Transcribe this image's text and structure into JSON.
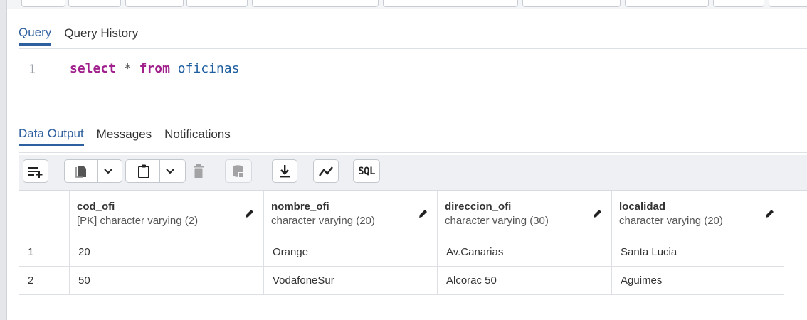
{
  "query_tabs": [
    "Query",
    "Query History"
  ],
  "editor": {
    "line_number": "1",
    "keyword_select": "select",
    "operator": "*",
    "keyword_from": "from",
    "table_name": "oficinas"
  },
  "output_tabs": [
    "Data Output",
    "Messages",
    "Notifications"
  ],
  "toolbar": {
    "sql_label": "SQL",
    "icons": [
      "add-row-icon",
      "copy-icon",
      "dropdown-chevron-icon",
      "paste-icon",
      "dropdown-chevron-icon",
      "delete-icon",
      "save-data-icon",
      "download-icon",
      "graph-icon",
      "sql-icon"
    ]
  },
  "columns": [
    {
      "name": "cod_ofi",
      "type": "[PK] character varying (2)"
    },
    {
      "name": "nombre_ofi",
      "type": "character varying (20)"
    },
    {
      "name": "direccion_ofi",
      "type": "character varying (30)"
    },
    {
      "name": "localidad",
      "type": "character varying (20)"
    }
  ],
  "rows": [
    {
      "num": "1",
      "cells": [
        "20",
        "Orange",
        "Av.Canarias",
        "Santa Lucia"
      ]
    },
    {
      "num": "2",
      "cells": [
        "50",
        "VodafoneSur",
        "Alcorac 50",
        "Aguimes"
      ]
    }
  ],
  "colors": {
    "accent": "#2e5f9e",
    "keyword": "#a0218c",
    "identifier": "#1f5fa0"
  }
}
